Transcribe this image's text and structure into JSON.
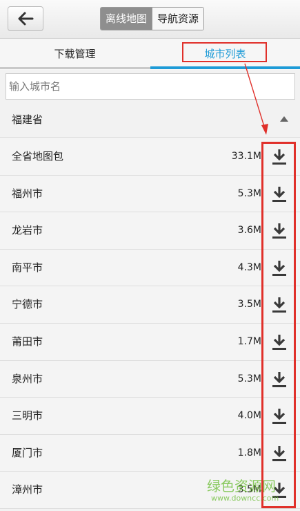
{
  "header": {
    "back_icon": "arrow-left-icon",
    "segments": [
      {
        "label": "离线地图",
        "active": true
      },
      {
        "label": "导航资源",
        "active": false
      }
    ]
  },
  "tabs": [
    {
      "label": "下载管理",
      "active": false
    },
    {
      "label": "城市列表",
      "active": true
    }
  ],
  "search": {
    "placeholder": "输入城市名"
  },
  "province": {
    "label": "福建省",
    "expanded": true
  },
  "cities": [
    {
      "name": "全省地图包",
      "size": "33.1M"
    },
    {
      "name": "福州市",
      "size": "5.3M"
    },
    {
      "name": "龙岩市",
      "size": "3.6M"
    },
    {
      "name": "南平市",
      "size": "4.3M"
    },
    {
      "name": "宁德市",
      "size": "3.5M"
    },
    {
      "name": "莆田市",
      "size": "1.7M"
    },
    {
      "name": "泉州市",
      "size": "5.3M"
    },
    {
      "name": "三明市",
      "size": "4.0M"
    },
    {
      "name": "厦门市",
      "size": "1.8M"
    },
    {
      "name": "漳州市",
      "size": "3.5M"
    }
  ],
  "watermark": {
    "title": "绿色资源网",
    "url": "www.downcc.com"
  },
  "colors": {
    "accent": "#1e9bd7",
    "annotation": "#e0302a",
    "watermark": "#6fbf3a"
  }
}
